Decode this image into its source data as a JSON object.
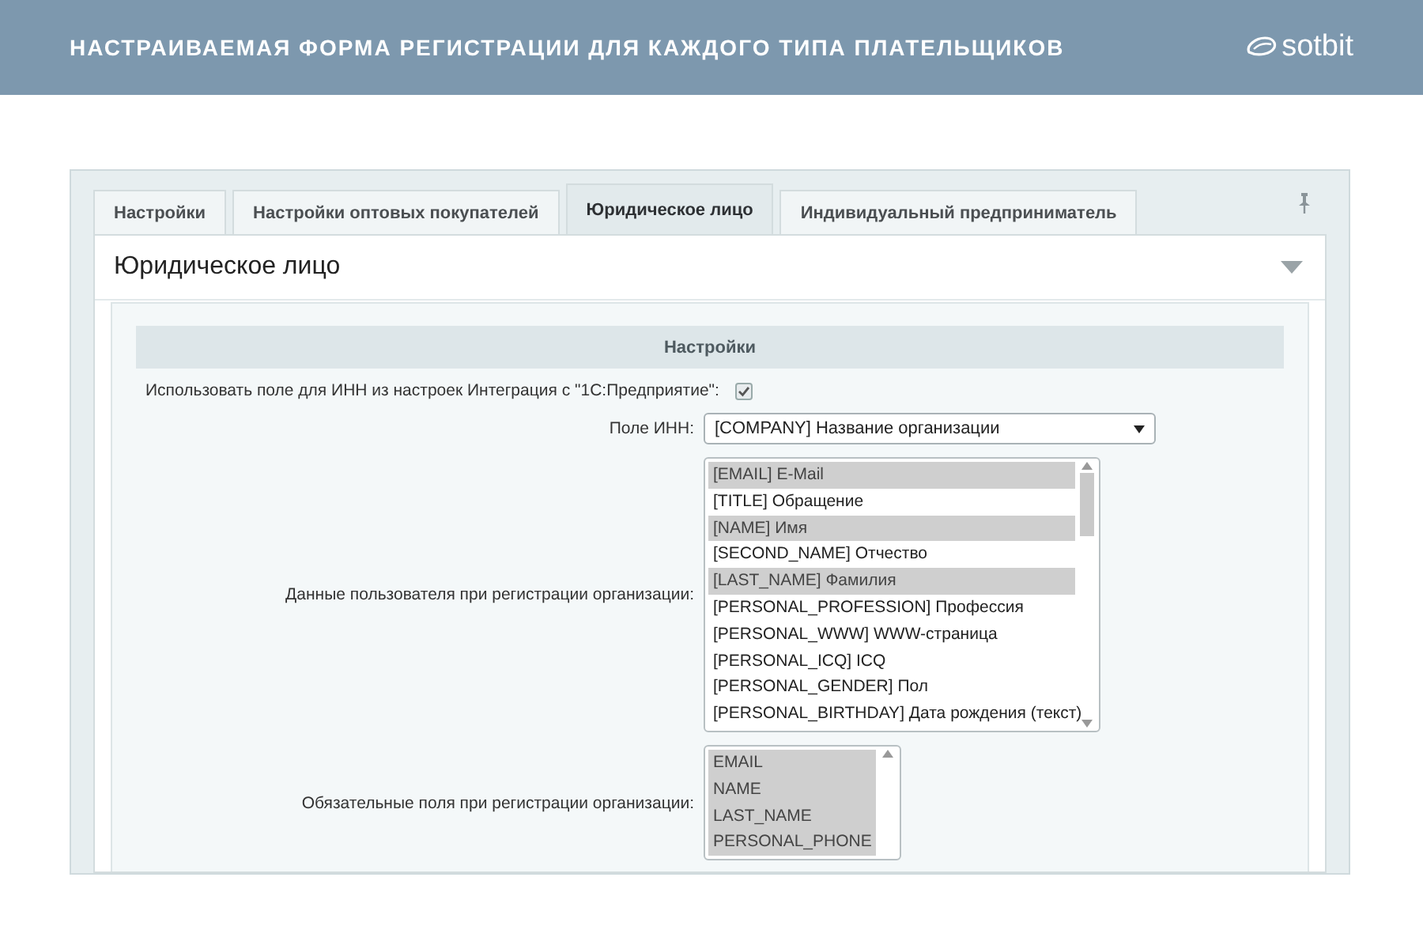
{
  "header": {
    "title": "НАСТРАИВАЕМАЯ ФОРМА РЕГИСТРАЦИИ ДЛЯ КАЖДОГО ТИПА ПЛАТЕЛЬЩИКОВ",
    "logo": "sotbit"
  },
  "tabs": [
    {
      "label": "Настройки",
      "selected": false
    },
    {
      "label": "Настройки оптовых покупателей",
      "selected": false
    },
    {
      "label": "Юридическое лицо",
      "selected": true
    },
    {
      "label": "Индивидуальный предприниматель",
      "selected": false
    }
  ],
  "section": {
    "title": "Юридическое лицо",
    "expanded": true
  },
  "settings_header": "Настройки",
  "fields": [
    {
      "kind": "checkbox",
      "label": "Использовать поле для ИНН из настроек Интеграция с \"1С:Предприятие\":",
      "checked": true
    },
    {
      "kind": "select",
      "label": "Поле ИНН:",
      "value": "[COMPANY] Название организации"
    },
    {
      "kind": "list",
      "label": "Данные пользователя при регистрации организации:",
      "options": [
        {
          "text": "[EMAIL] E-Mail",
          "selected": true
        },
        {
          "text": "[TITLE] Обращение",
          "selected": false
        },
        {
          "text": "[NAME] Имя",
          "selected": true
        },
        {
          "text": "[SECOND_NAME] Отчество",
          "selected": false
        },
        {
          "text": "[LAST_NAME] Фамилия",
          "selected": true
        },
        {
          "text": "[PERSONAL_PROFESSION] Профессия",
          "selected": false
        },
        {
          "text": "[PERSONAL_WWW] WWW-страница",
          "selected": false
        },
        {
          "text": "[PERSONAL_ICQ] ICQ",
          "selected": false
        },
        {
          "text": "[PERSONAL_GENDER] Пол",
          "selected": false
        },
        {
          "text": "[PERSONAL_BIRTHDAY] Дата рождения (текст)",
          "selected": false
        }
      ]
    },
    {
      "kind": "list",
      "label": "Обязательные поля при регистрации организации:",
      "options": [
        {
          "text": "EMAIL",
          "selected": true
        },
        {
          "text": "NAME",
          "selected": true
        },
        {
          "text": "LAST_NAME",
          "selected": true
        },
        {
          "text": "PERSONAL_PHONE",
          "selected": true
        }
      ]
    }
  ]
}
